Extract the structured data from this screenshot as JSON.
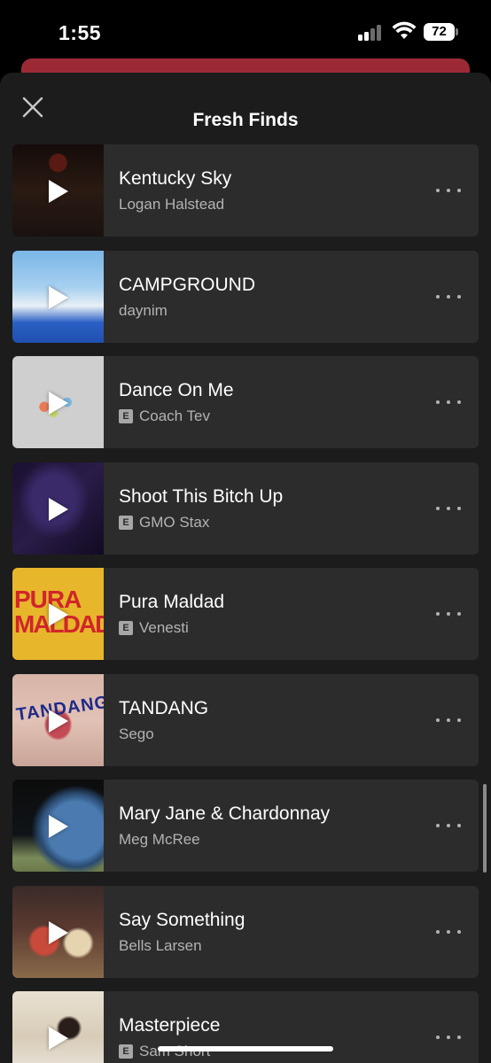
{
  "status_bar": {
    "time": "1:55",
    "battery": "72"
  },
  "sheet": {
    "title": "Fresh Finds",
    "close_icon": "close-icon"
  },
  "tracks": [
    {
      "title": "Kentucky Sky",
      "artist": "Logan Halstead",
      "explicit": false
    },
    {
      "title": "CAMPGROUND",
      "artist": "daynim",
      "explicit": false
    },
    {
      "title": "Dance On Me",
      "artist": "Coach Tev",
      "explicit": true
    },
    {
      "title": "Shoot This Bitch Up",
      "artist": "GMO Stax",
      "explicit": true
    },
    {
      "title": "Pura Maldad",
      "artist": "Venesti",
      "explicit": true,
      "art_text": [
        "PURA",
        "MALDAD"
      ]
    },
    {
      "title": "TANDANG",
      "artist": "Sego",
      "explicit": false,
      "art_text": [
        "TANDANG"
      ]
    },
    {
      "title": "Mary Jane & Chardonnay",
      "artist": "Meg McRee",
      "explicit": false
    },
    {
      "title": "Say Something",
      "artist": "Bells Larsen",
      "explicit": false
    },
    {
      "title": "Masterpiece",
      "artist": "Sam Short",
      "explicit": true
    }
  ],
  "explicit_badge": "E",
  "colors": {
    "sheet_bg": "#1c1c1c",
    "card_bg": "#2c2c2c",
    "banner": "#9c2a35",
    "secondary_text": "#b3b3b3"
  }
}
